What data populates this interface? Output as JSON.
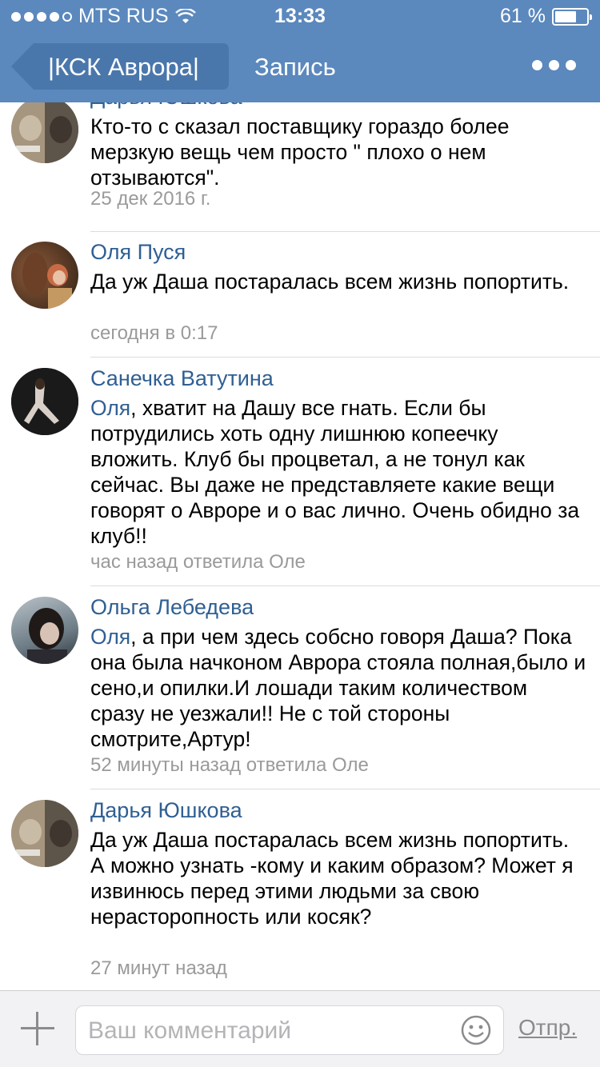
{
  "status_bar": {
    "carrier": "MTS RUS",
    "time": "13:33",
    "battery": "61 %",
    "battery_level": 0.61
  },
  "nav": {
    "back_label": "|КСК Аврора|",
    "title": "Запись",
    "more_icon": "more-dots-icon"
  },
  "comments": [
    {
      "author": "Дарья Юшкова",
      "text": "Кто-то с сказал поставщику гораздо более мерзкую вещь чем просто \" плохо о нем отзываются\".",
      "meta": "25 дек 2016 г."
    },
    {
      "author": "Оля Пуся",
      "text": "Да уж Даша постаралась всем жизнь попортить.",
      "meta": "сегодня в 0:17"
    },
    {
      "author": "Санечка Ватутина",
      "mention": "Оля",
      "text": ", хватит на Дашу все гнать. Если бы потрудились хоть одну лишнюю копеечку вложить. Клуб бы процветал, а не тонул как сейчас. Вы даже не представляете какие вещи говорят о Авроре и о вас лично. Очень обидно за клуб!!",
      "meta": "час назад ответила Оле"
    },
    {
      "author": "Ольга Лебедева",
      "mention": "Оля",
      "text": ", а при чем здесь собсно говоря Даша? Пока она была начконом Аврора стояла полная,было и сено,и опилки.И лошади таким количеством сразу не уезжали!! Не с той стороны смотрите,Артур!",
      "meta": "52 минуты назад ответила Оле"
    },
    {
      "author": "Дарья Юшкова",
      "text": "Да уж Даша постаралась всем жизнь попортить.         А можно узнать -кому и каким образом? Может я извинюсь перед этими людьми за свою нерасторопность или косяк?",
      "meta": "27 минут назад"
    }
  ],
  "composer": {
    "placeholder": "Ваш комментарий",
    "send_label": "Отпр."
  },
  "colors": {
    "header": "#5b88bd",
    "link": "#2f5f93",
    "meta": "#9a9a9a"
  }
}
